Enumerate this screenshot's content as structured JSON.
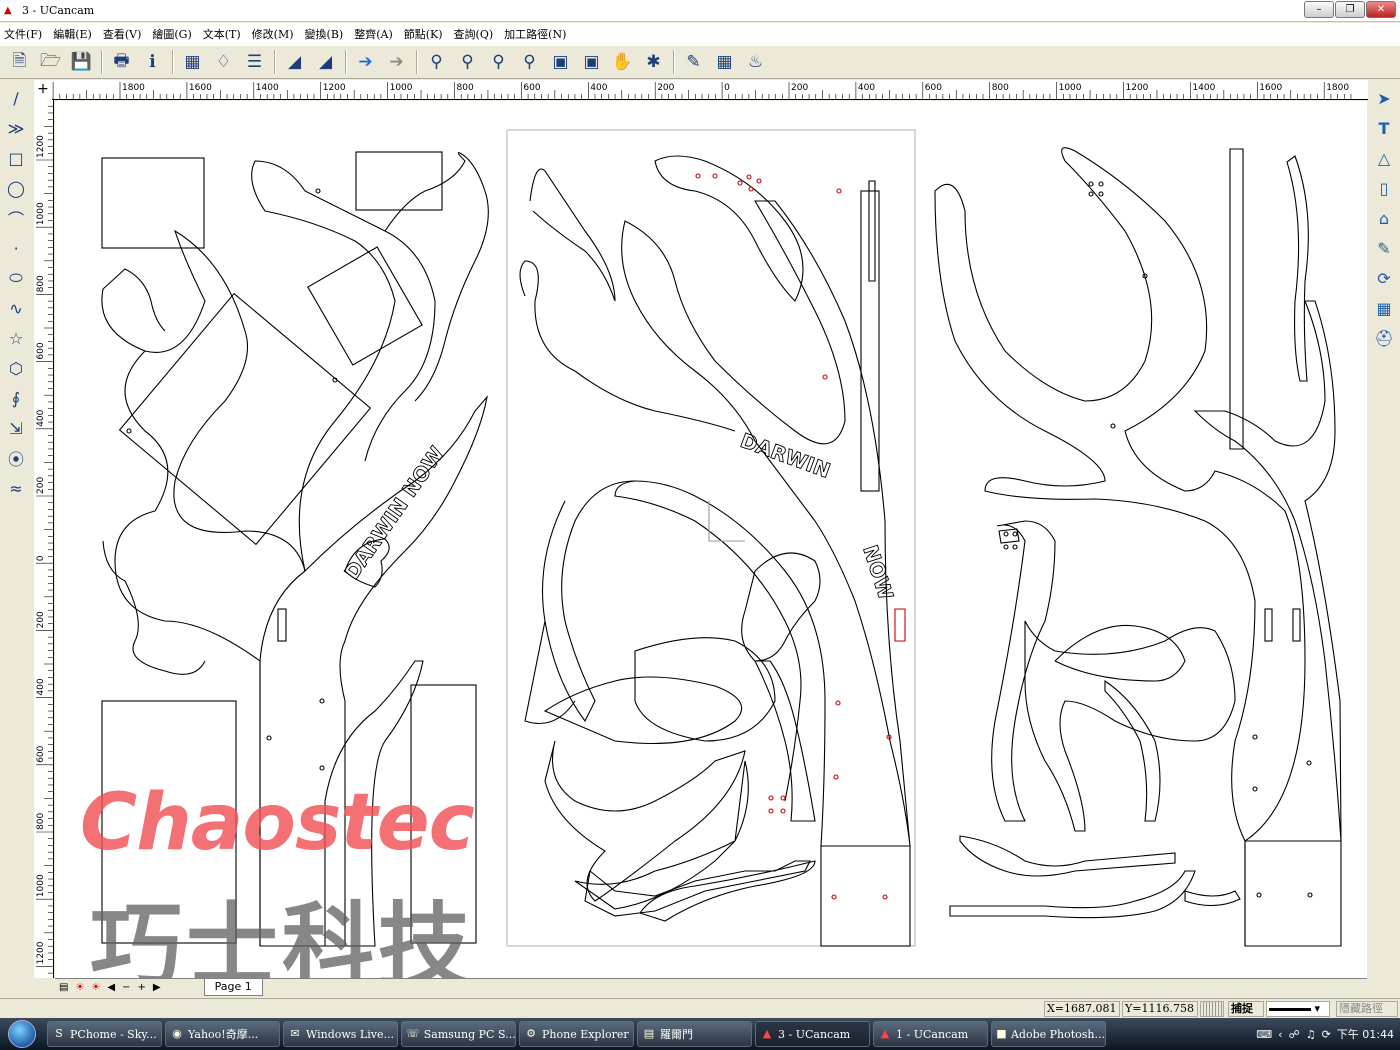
{
  "window": {
    "title": "3 - UCancam"
  },
  "menu": [
    "文件(F)",
    "編輯(E)",
    "查看(V)",
    "繪圖(G)",
    "文本(T)",
    "修改(M)",
    "變換(B)",
    "整齊(A)",
    "節點(K)",
    "查詢(Q)",
    "加工路徑(N)"
  ],
  "toolbar_icons": [
    "new-file-icon",
    "open-folder-icon",
    "save-icon",
    "print-icon",
    "info-icon",
    "import-icon",
    "shield-icon",
    "layers-icon",
    "ruler-icon",
    "triangle-ruler-icon",
    "back-arrow-icon",
    "forward-arrow-icon",
    "zoom-window-icon",
    "zoom-in-icon",
    "zoom-out-icon",
    "zoom-all-icon",
    "zoom-page-icon",
    "zoom-selection-icon",
    "pan-hand-icon",
    "origin-icon",
    "pencil-tool-icon",
    "text-grid-icon",
    "render-icon"
  ],
  "left_tools": [
    "line-icon",
    "polyline-icon",
    "rectangle-icon",
    "circle-icon",
    "arc-icon",
    "point-icon",
    "ellipse-icon",
    "spline-icon",
    "star-icon",
    "polygon-icon",
    "offset-icon",
    "arrow-icon",
    "spiral-icon",
    "wave-icon"
  ],
  "right_tools": [
    "select-arrow-icon",
    "text-tool-icon",
    "node-edit-icon",
    "eraser-icon",
    "house-icon",
    "toolpath-icon",
    "rotate-icon",
    "grid-icon",
    "cutter-icon"
  ],
  "ruler": {
    "h_labels": [
      "1800",
      "1600",
      "1400",
      "1200",
      "1000",
      "800",
      "600",
      "400",
      "200",
      "0",
      "200",
      "400",
      "600",
      "800",
      "1000",
      "1200",
      "1400",
      "1600",
      "1800"
    ],
    "v_labels": [
      "1200",
      "1000",
      "800",
      "600",
      "400",
      "200",
      "0",
      "200",
      "400",
      "600",
      "800",
      "1000",
      "1200"
    ]
  },
  "canvas": {
    "panel1_text": "DARWIN NOW",
    "panel2_text_a": "DARWIN",
    "panel2_text_b": "NOW"
  },
  "watermark": {
    "brand_en": "Chaostec",
    "brand_zh": "巧士科技"
  },
  "page_tab": "Page 1",
  "status": {
    "x": "X=1687.081",
    "y": "Y=1116.758",
    "snap": "捕捉",
    "right_label": "隱藏路徑"
  },
  "taskbar": {
    "tasks": [
      {
        "icon": "skype-icon",
        "label": "PChome - Sky..."
      },
      {
        "icon": "browser-icon",
        "label": "Yahoo!奇摩..."
      },
      {
        "icon": "mail-icon",
        "label": "Windows Live..."
      },
      {
        "icon": "phone-icon",
        "label": "Samsung PC S..."
      },
      {
        "icon": "explorer-icon",
        "label": "Phone Explorer"
      },
      {
        "icon": "folder-icon",
        "label": "羅爾門"
      },
      {
        "icon": "ucancam-icon",
        "label": "3 - UCancam"
      },
      {
        "icon": "ucancam-icon",
        "label": "1 - UCancam"
      },
      {
        "icon": "photoshop-icon",
        "label": "Adobe Photosh..."
      }
    ],
    "clock": "下午 01:44"
  }
}
